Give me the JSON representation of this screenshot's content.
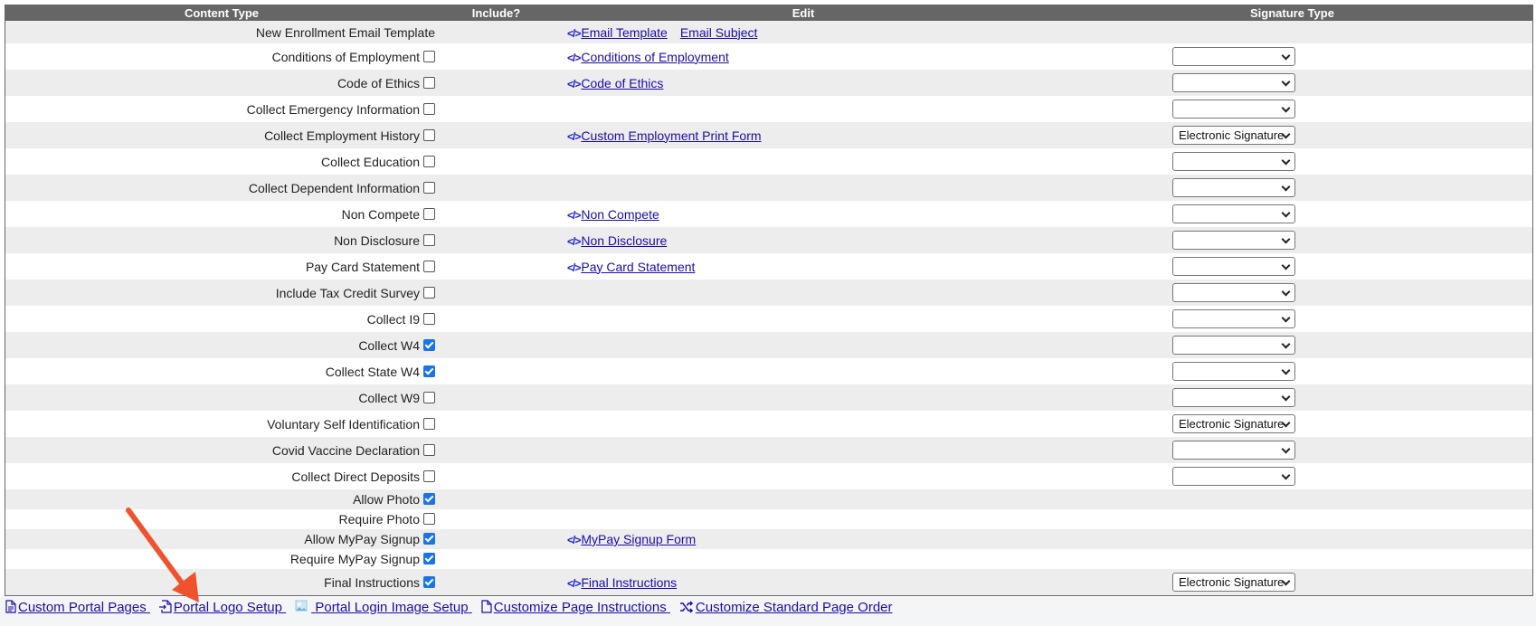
{
  "table": {
    "headers": [
      "Content Type",
      "Include?",
      "Edit",
      "Signature Type"
    ],
    "rows": [
      {
        "label": "New Enrollment Email Template",
        "checkbox": null,
        "links": [
          "Email Template",
          "Email Subject"
        ],
        "select": null
      },
      {
        "label": "Conditions of Employment",
        "checkbox": false,
        "links": [
          "Conditions of Employment"
        ],
        "select": ""
      },
      {
        "label": "Code of Ethics",
        "checkbox": false,
        "links": [
          "Code of Ethics"
        ],
        "select": ""
      },
      {
        "label": "Collect Emergency Information",
        "checkbox": false,
        "links": [],
        "select": ""
      },
      {
        "label": "Collect Employment History",
        "checkbox": false,
        "links": [
          "Custom Employment Print Form"
        ],
        "select": "Electronic Signature"
      },
      {
        "label": "Collect Education",
        "checkbox": false,
        "links": [],
        "select": ""
      },
      {
        "label": "Collect Dependent Information",
        "checkbox": false,
        "links": [],
        "select": ""
      },
      {
        "label": "Non Compete",
        "checkbox": false,
        "links": [
          "Non Compete"
        ],
        "select": ""
      },
      {
        "label": "Non Disclosure",
        "checkbox": false,
        "links": [
          "Non Disclosure"
        ],
        "select": ""
      },
      {
        "label": "Pay Card Statement",
        "checkbox": false,
        "links": [
          "Pay Card Statement"
        ],
        "select": ""
      },
      {
        "label": "Include Tax Credit Survey",
        "checkbox": false,
        "links": [],
        "select": ""
      },
      {
        "label": "Collect I9",
        "checkbox": false,
        "links": [],
        "select": ""
      },
      {
        "label": "Collect W4",
        "checkbox": true,
        "links": [],
        "select": ""
      },
      {
        "label": "Collect State W4",
        "checkbox": true,
        "links": [],
        "select": ""
      },
      {
        "label": "Collect W9",
        "checkbox": false,
        "links": [],
        "select": ""
      },
      {
        "label": "Voluntary Self Identification",
        "checkbox": false,
        "links": [],
        "select": "Electronic Signature"
      },
      {
        "label": "Covid Vaccine Declaration",
        "checkbox": false,
        "links": [],
        "select": ""
      },
      {
        "label": "Collect Direct Deposits",
        "checkbox": false,
        "links": [],
        "select": ""
      },
      {
        "label": "Allow Photo",
        "checkbox": true,
        "links": [],
        "select": null
      },
      {
        "label": "Require Photo",
        "checkbox": false,
        "links": [],
        "select": null
      },
      {
        "label": "Allow MyPay Signup",
        "checkbox": true,
        "links": [
          "MyPay Signup Form"
        ],
        "select": null
      },
      {
        "label": "Require MyPay Signup",
        "checkbox": true,
        "links": [],
        "select": null
      },
      {
        "label": "Final Instructions",
        "checkbox": true,
        "links": [
          "Final Instructions"
        ],
        "select": "Electronic Signature"
      }
    ]
  },
  "footer": {
    "links": [
      {
        "label": "Custom Portal Pages",
        "icon": "document-icon"
      },
      {
        "label": "Portal Logo Setup",
        "icon": "document-import-icon"
      },
      {
        "label": "Portal Login Image Setup",
        "icon": "image-icon"
      },
      {
        "label": "Customize Page Instructions",
        "icon": "blank-document-icon"
      },
      {
        "label": "Customize Standard Page Order",
        "icon": "shuffle-icon"
      }
    ]
  },
  "colors": {
    "header_bg": "#666666",
    "link": "#1a0dab",
    "code_icon": "#1d1dd6",
    "checked": "#1a73e8",
    "arrow": "#f0522d"
  }
}
